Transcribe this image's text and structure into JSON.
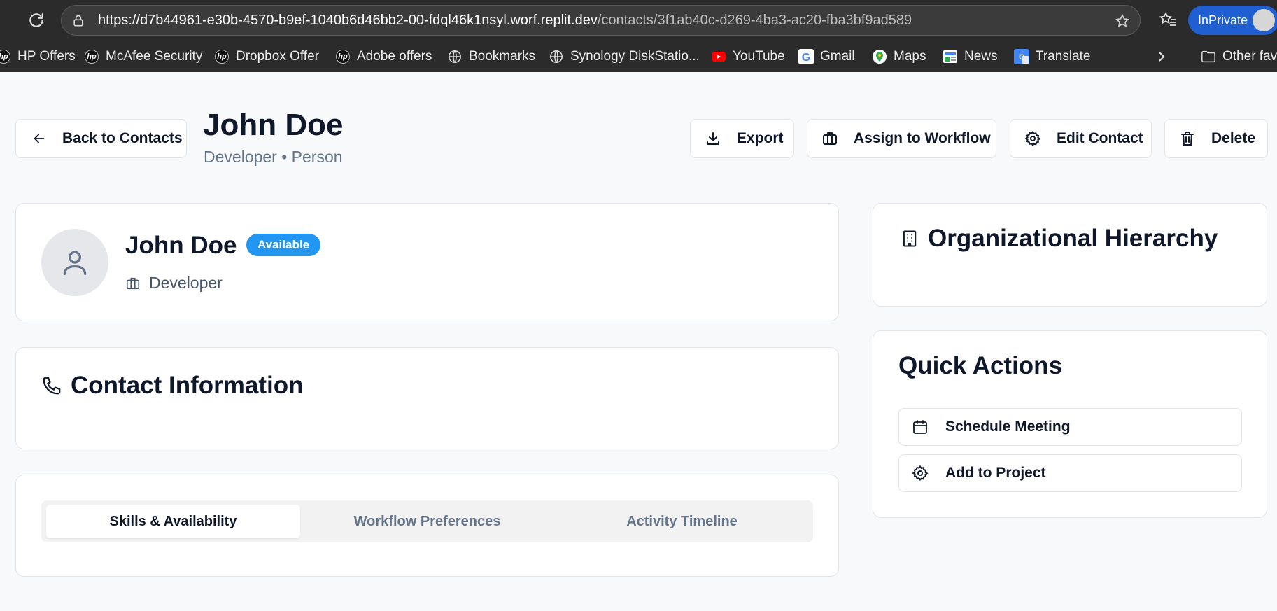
{
  "browser": {
    "url_host": "https://d7b44961-e30b-4570-b9ef-1040b6d46bb2-00-fdql46k1nsyl.worf.replit.dev",
    "url_path": "/contacts/3f1ab40c-d269-4ba3-ac20-fba3bf9ad589",
    "profile_label": "InPrivate",
    "bookmarks": [
      {
        "label": "HP Offers",
        "icon": "hp-logo-icon"
      },
      {
        "label": "McAfee Security",
        "icon": "hp-logo-icon"
      },
      {
        "label": "Dropbox Offer",
        "icon": "hp-logo-icon"
      },
      {
        "label": "Adobe offers",
        "icon": "hp-logo-icon"
      },
      {
        "label": "Bookmarks",
        "icon": "globe-icon"
      },
      {
        "label": "Synology DiskStatio...",
        "icon": "globe-icon"
      },
      {
        "label": "YouTube",
        "icon": "youtube-icon"
      },
      {
        "label": "Gmail",
        "icon": "google-icon"
      },
      {
        "label": "Maps",
        "icon": "maps-icon"
      },
      {
        "label": "News",
        "icon": "news-icon"
      },
      {
        "label": "Translate",
        "icon": "translate-icon"
      }
    ],
    "other_favorites": "Other favo"
  },
  "header": {
    "back_label": "Back to Contacts",
    "title": "John Doe",
    "subtitle": "Developer • Person",
    "actions": {
      "export": "Export",
      "assign": "Assign to Workflow",
      "edit": "Edit Contact",
      "delete": "Delete"
    }
  },
  "profile": {
    "name": "John Doe",
    "status": "Available",
    "role": "Developer"
  },
  "contact_info": {
    "title": "Contact Information"
  },
  "tabs": [
    {
      "label": "Skills & Availability",
      "active": true
    },
    {
      "label": "Workflow Preferences",
      "active": false
    },
    {
      "label": "Activity Timeline",
      "active": false
    }
  ],
  "org": {
    "title": "Organizational Hierarchy"
  },
  "quick_actions": {
    "title": "Quick Actions",
    "schedule": "Schedule Meeting",
    "add_project": "Add to Project"
  },
  "colors": {
    "badge": "#2196f3",
    "inprivate": "#1f5fd1"
  }
}
